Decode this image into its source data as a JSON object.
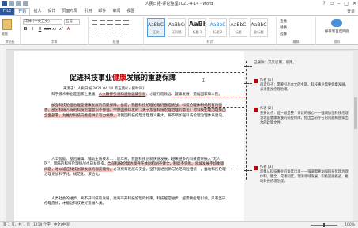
{
  "window": {
    "title": "人民日报-评论整理2021-4-14 - Word",
    "controls": [
      "?",
      "▭",
      "–",
      "□",
      "✕"
    ]
  },
  "ribbon": {
    "file_tab": "FILE",
    "tabs": [
      "开始",
      "插入",
      "设计",
      "页面布局",
      "引用",
      "邮件",
      "审阅",
      "视图"
    ],
    "user": "登录",
    "clipboard": {
      "paste": "粘贴",
      "group": "剪贴板"
    },
    "font": {
      "name": "宋体 (中文正文)",
      "size": "五号",
      "group": "字体",
      "buttons": [
        "B",
        "I",
        "U",
        "abc",
        "x₂",
        "x²",
        "A"
      ]
    },
    "paragraph": {
      "group": "段落"
    },
    "styles": {
      "group": "样式",
      "items": [
        {
          "sample": "AaBbCcDc",
          "name": "正文"
        },
        {
          "sample": "AaBbCcDc",
          "name": "无间隔"
        },
        {
          "sample": "AaBb",
          "name": "标题 1"
        },
        {
          "sample": "AaBbC",
          "name": "标题 2"
        },
        {
          "sample": "AaBbC",
          "name": "标题"
        },
        {
          "sample": "AaBbC",
          "name": "副标题"
        }
      ]
    },
    "editing": {
      "items": [
        "查找",
        "替换",
        "选择"
      ],
      "group": "编辑"
    },
    "acc_icon": {
      "label": "保存到百度网盘",
      "group": "保存"
    }
  },
  "document": {
    "title_before": "促进科技事业",
    "title_red": "健康",
    "title_after": "发展的重要保障",
    "byline": "来源于：人民日报 2021.04.14 第五版(《人民时评》)",
    "paragraphs": [
      {
        "pre": "科学技术事业是国家之重器，",
        "hl": "人文精神引领和道德健康引领",
        "post": "，才能行稳致远、健康发展，造福国家和人民。"
      },
      {
        "pre": "",
        "hl": "加强科技伦理治理是健康发展的前提保障。当前，我国科技伦理治理仍面临挑战，科技伦理体制机制有待完善，部分科研人员的科技伦理意识不够强。中办国办印发的《关于加强科技伦理治理的意见》对科技伦理治理作出全面部署，为推动科技向善提供了有力保障。",
        "post": "对我国科技伦理治理意义重大，要不断加强科技伦理治理体系建设。"
      },
      {
        "pre": "人工智能、基因编辑、辅助生殖技术……近年来，我国科技创新快速发展，越来越多的科技成果融入“无人区”，面临的科技伦理挑战也日益增多。",
        "hl": "当前科技伦理治理存在体制机制不健全、制度不完善、领域发展不均衡等问题，难以适应科技创新发展的现实需要。",
        "post": "必须统筹发展与安全，坚持促进创新与防范风险相统一，推动科技伦理治理更加科学化、规范化、法治化。"
      },
      {
        "pre": "人类社会的进步，离不开科技的发展，更离不开科技伦理的约束。科技越是进步，越需要伦理引领。只有坚守伦理底线，才能让科技更好造福人类。",
        "hl": "",
        "post": ""
      }
    ]
  },
  "comments": {
    "change_note": "已删除：交叉引用，引用。",
    "items": [
      {
        "who": "作者 [1]",
        "text": "再造句子：需要引出本文的主题。科技事业需要健康发展，必须重视伦理治理。"
      },
      {
        "who": "作者 [2]",
        "text": "重要论点：这一段是整个论证的核心——强调加强科技伦理治理是健康发展的前提保障，指出当前存在的问题和国家出台的政策文件。"
      },
      {
        "who": "作者 [3]",
        "text": "现象从科技事业的角度出发——强调需要加强科技伦理治理体制，健全、完善制度，理清领域发展，积极迎接挑战，推动科技伦理治理。"
      }
    ]
  },
  "statusbar": {
    "page": "第 1 页，共 1 页",
    "words": "1219 个字",
    "lang": "中文(中国)",
    "zoom": "100%"
  },
  "taskbar": {
    "start_label": "W"
  }
}
